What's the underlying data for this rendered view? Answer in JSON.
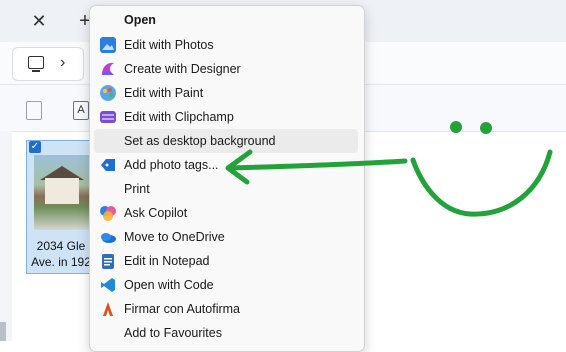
{
  "tab": {
    "close_glyph": "✕",
    "new_glyph": "+"
  },
  "address": {
    "chevron_glyph": "›"
  },
  "toolbar": {
    "text_icon_glyph": "A"
  },
  "thumbnail": {
    "caption": "2034 Gle Ave. in 192",
    "check_glyph": "✓"
  },
  "context_menu": {
    "items": [
      {
        "label": "Open",
        "icon": "open",
        "bold": true,
        "highlight": false
      },
      {
        "label": "Edit with Photos",
        "icon": "photos-icon",
        "bold": false,
        "highlight": false
      },
      {
        "label": "Create with Designer",
        "icon": "designer-icon",
        "bold": false,
        "highlight": false
      },
      {
        "label": "Edit with Paint",
        "icon": "paint-icon",
        "bold": false,
        "highlight": false
      },
      {
        "label": "Edit with Clipchamp",
        "icon": "clipchamp-icon",
        "bold": false,
        "highlight": false
      },
      {
        "label": "Set as desktop background",
        "icon": "none",
        "bold": false,
        "highlight": true
      },
      {
        "label": "Add photo tags...",
        "icon": "tag-icon",
        "bold": false,
        "highlight": false
      },
      {
        "label": "Print",
        "icon": "none",
        "bold": false,
        "highlight": false
      },
      {
        "label": "Ask Copilot",
        "icon": "copilot-icon",
        "bold": false,
        "highlight": false
      },
      {
        "label": "Move to OneDrive",
        "icon": "onedrive-icon",
        "bold": false,
        "highlight": false
      },
      {
        "label": "Edit in Notepad",
        "icon": "notepad-icon",
        "bold": false,
        "highlight": false
      },
      {
        "label": "Open with Code",
        "icon": "vscode-icon",
        "bold": false,
        "highlight": false
      },
      {
        "label": "Firmar con Autofirma",
        "icon": "autofirma-icon",
        "bold": false,
        "highlight": false
      },
      {
        "label": "Add to Favourites",
        "icon": "none",
        "bold": false,
        "highlight": false
      }
    ]
  },
  "colors": {
    "annotation_green": "#22a33a",
    "accent_blue": "#1f6fd1"
  }
}
